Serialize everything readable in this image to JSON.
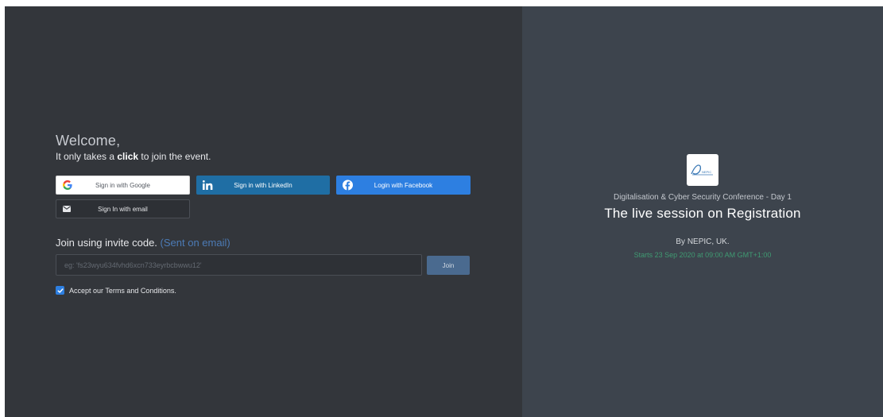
{
  "login": {
    "welcome_title": "Welcome,",
    "welcome_prefix": "It only takes a ",
    "welcome_bold": "click",
    "welcome_suffix": " to join the event.",
    "buttons": {
      "google": "Sign in with Google",
      "linkedin": "Sign in with LinkedIn",
      "facebook": "Login with Facebook",
      "email": "Sign In with email"
    },
    "invite": {
      "title": "Join using invite code.",
      "sent_note": "(Sent on email)",
      "placeholder": "eg: 'fs23wyu634fvhd6xcn733eyrbcbwwu12'",
      "join_label": "Join"
    },
    "terms_label": "Accept our Terms and Conditions.",
    "terms_checked": true
  },
  "event": {
    "logo_icon": "nepic-logo",
    "logo_text": "NEPIC",
    "series": "Digitalisation & Cyber Security Conference - Day 1",
    "title": "The live session on Registration",
    "by": "By NEPIC, UK.",
    "starts": "Starts 23 Sep 2020 at 09:00 AM GMT+1:00"
  },
  "colors": {
    "left_bg": "#33363b",
    "right_bg": "#3d444d",
    "linkedin": "#1f6ea4",
    "facebook": "#2d7fe1",
    "accent_link": "#4c7bb6",
    "start_green": "#3f9a72"
  }
}
